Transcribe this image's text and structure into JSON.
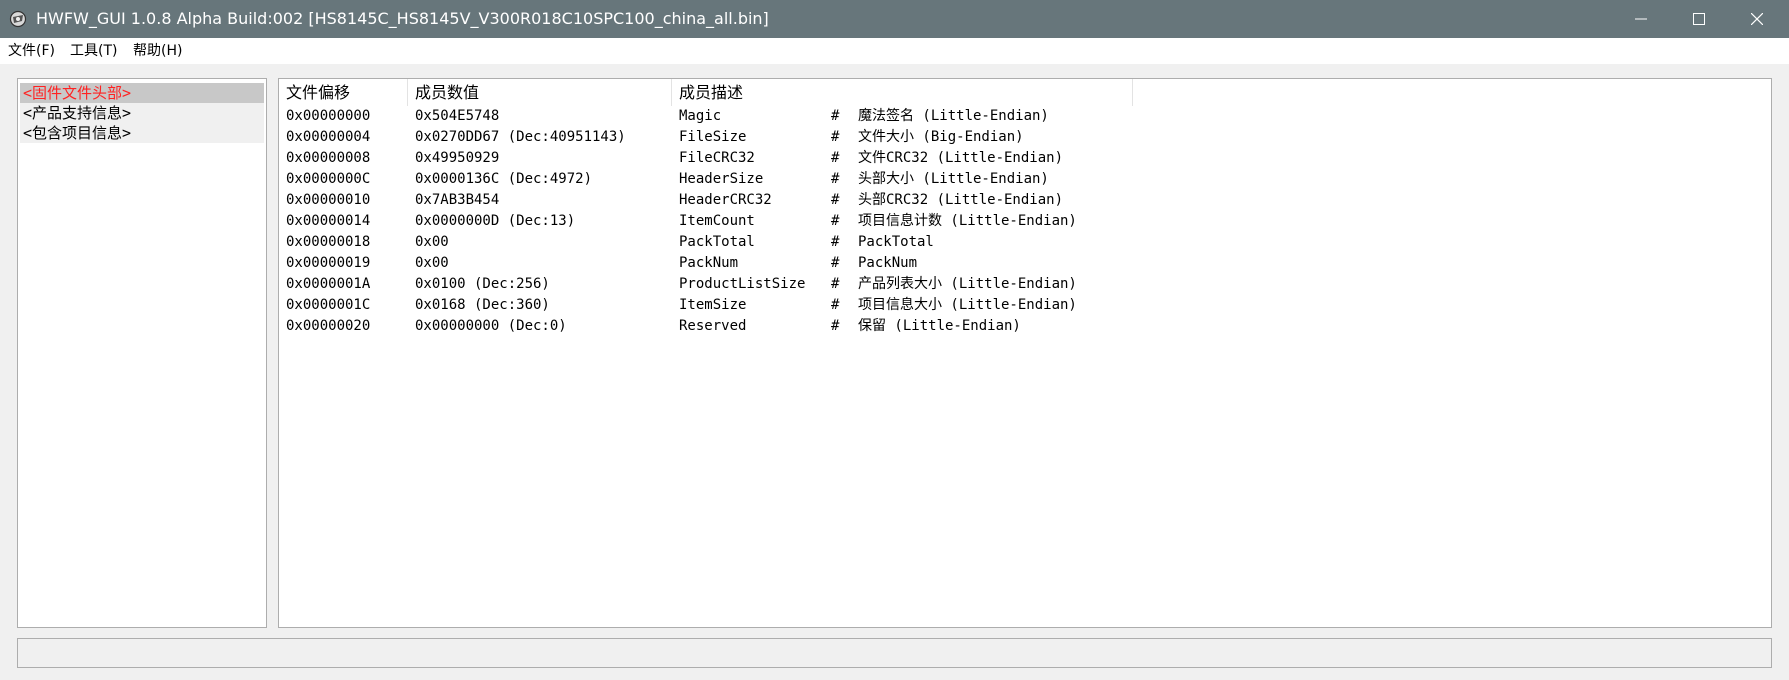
{
  "window": {
    "title": "HWFW_GUI 1.0.8 Alpha Build:002 [HS8145C_HS8145V_V300R018C10SPC100_china_all.bin]",
    "icon": "app-icon",
    "controls": [
      "minimize-icon",
      "maximize-icon",
      "close-icon"
    ]
  },
  "menu": {
    "items": [
      {
        "label": "文件(F)"
      },
      {
        "label": "工具(T)"
      },
      {
        "label": "帮助(H)"
      }
    ]
  },
  "tree": {
    "items": [
      {
        "label": "<固件文件头部>",
        "selected": true
      },
      {
        "label": "<产品支持信息>",
        "selected": false
      },
      {
        "label": "<包含项目信息>",
        "selected": false
      }
    ]
  },
  "table": {
    "columns": [
      {
        "label": "文件偏移"
      },
      {
        "label": "成员数值"
      },
      {
        "label": "成员描述"
      }
    ],
    "rows": [
      {
        "offset": "0x00000000",
        "value": "0x504E5748",
        "member": "Magic",
        "hash": "#",
        "desc": "魔法签名  (Little-Endian)"
      },
      {
        "offset": "0x00000004",
        "value": "0x0270DD67  (Dec:40951143)",
        "member": "FileSize",
        "hash": "#",
        "desc": "文件大小  (Big-Endian)"
      },
      {
        "offset": "0x00000008",
        "value": "0x49950929",
        "member": "FileCRC32",
        "hash": "#",
        "desc": "文件CRC32  (Little-Endian)"
      },
      {
        "offset": "0x0000000C",
        "value": "0x0000136C  (Dec:4972)",
        "member": "HeaderSize",
        "hash": "#",
        "desc": "头部大小  (Little-Endian)"
      },
      {
        "offset": "0x00000010",
        "value": "0x7AB3B454",
        "member": "HeaderCRC32",
        "hash": "#",
        "desc": "头部CRC32  (Little-Endian)"
      },
      {
        "offset": "0x00000014",
        "value": "0x0000000D  (Dec:13)",
        "member": "ItemCount",
        "hash": "#",
        "desc": "项目信息计数  (Little-Endian)"
      },
      {
        "offset": "0x00000018",
        "value": "0x00",
        "member": "PackTotal",
        "hash": "#",
        "desc": "PackTotal"
      },
      {
        "offset": "0x00000019",
        "value": "0x00",
        "member": "PackNum",
        "hash": "#",
        "desc": "PackNum"
      },
      {
        "offset": "0x0000001A",
        "value": "0x0100  (Dec:256)",
        "member": "ProductListSize",
        "hash": "#",
        "desc": "产品列表大小  (Little-Endian)"
      },
      {
        "offset": "0x0000001C",
        "value": "0x0168  (Dec:360)",
        "member": "ItemSize",
        "hash": "#",
        "desc": "项目信息大小  (Little-Endian)"
      },
      {
        "offset": "0x00000020",
        "value": "0x00000000  (Dec:0)",
        "member": "Reserved",
        "hash": "#",
        "desc": "保留  (Little-Endian)"
      }
    ]
  },
  "status": {
    "text": ""
  },
  "colors": {
    "titlebar": "#67767b",
    "selected_text": "#ff2222",
    "selected_bg": "#c8c8c8"
  }
}
